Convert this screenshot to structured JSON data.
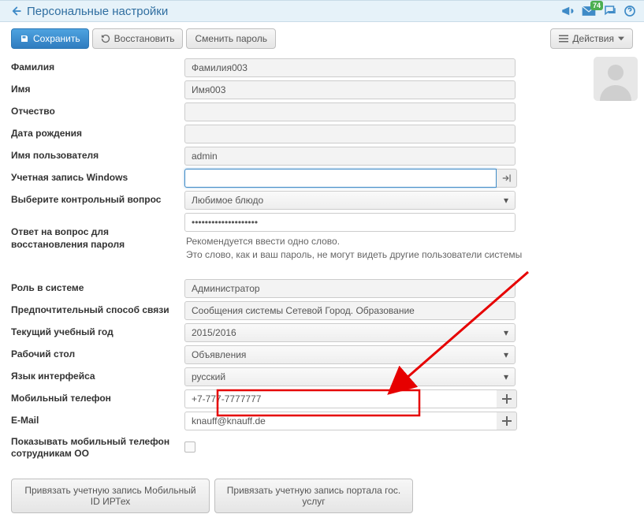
{
  "header": {
    "title": "Персональные настройки",
    "badge_count": "74"
  },
  "toolbar": {
    "save_label": "Сохранить",
    "restore_label": "Восстановить",
    "change_password_label": "Сменить пароль",
    "actions_label": "Действия"
  },
  "labels": {
    "lastname": "Фамилия",
    "firstname": "Имя",
    "patronymic": "Отчество",
    "birthdate": "Дата рождения",
    "username": "Имя пользователя",
    "windows_account": "Учетная запись Windows",
    "security_question": "Выберите контрольный вопрос",
    "security_answer": "Ответ на вопрос для восстановления пароля",
    "role": "Роль в системе",
    "contact_method": "Предпочтительный способ связи",
    "school_year": "Текущий учебный год",
    "desktop": "Рабочий стол",
    "ui_language": "Язык интерфейса",
    "mobile": "Мобильный телефон",
    "email": "E-Mail",
    "show_mobile": "Показывать мобильный телефон сотрудникам ОО"
  },
  "values": {
    "lastname": "Фамилия003",
    "firstname": "Имя003",
    "patronymic": "",
    "birthdate": "",
    "username": "admin",
    "windows_account": "",
    "security_question": "Любимое блюдо",
    "security_answer": "••••••••••••••••••••",
    "role": "Администратор",
    "contact_method": "Сообщения системы Сетевой Город. Образование",
    "school_year": "2015/2016",
    "desktop": "Объявления",
    "ui_language": "русский",
    "mobile": "+7-777-7777777",
    "email": "knauff@knauff.de"
  },
  "hints": {
    "answer_l1": "Рекомендуется ввести одно слово.",
    "answer_l2": "Это слово, как и ваш пароль, не могут видеть другие пользователи системы"
  },
  "bottom": {
    "link_mobile_id": "Привязать учетную запись Мобильный ID ИРТех",
    "link_gosuslugi": "Привязать учетную запись портала гос. услуг"
  }
}
